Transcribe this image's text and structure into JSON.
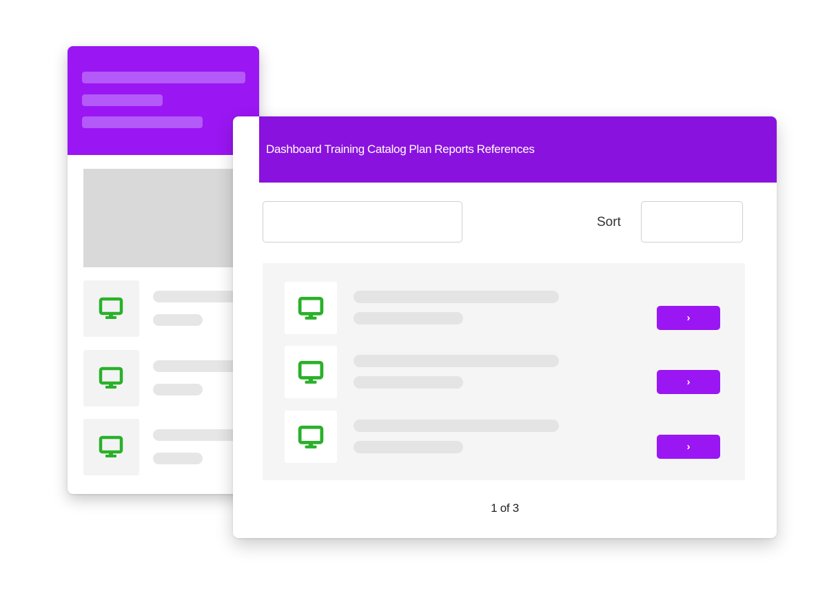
{
  "nav": {
    "items": [
      "Dashboard",
      "Training",
      "Catalog",
      "Plan",
      "Reports",
      "References"
    ]
  },
  "toolbar": {
    "sort_label": "Sort"
  },
  "list": {
    "rows": [
      {
        "icon": "monitor-icon",
        "button_label": "›"
      },
      {
        "icon": "monitor-icon",
        "button_label": "›"
      },
      {
        "icon": "monitor-icon",
        "button_label": "›"
      }
    ]
  },
  "pagination": {
    "text": "1 of 3"
  },
  "colors": {
    "accent": "#9a16f3",
    "nav_bg": "#8a12de",
    "icon_green": "#2ab02a"
  }
}
